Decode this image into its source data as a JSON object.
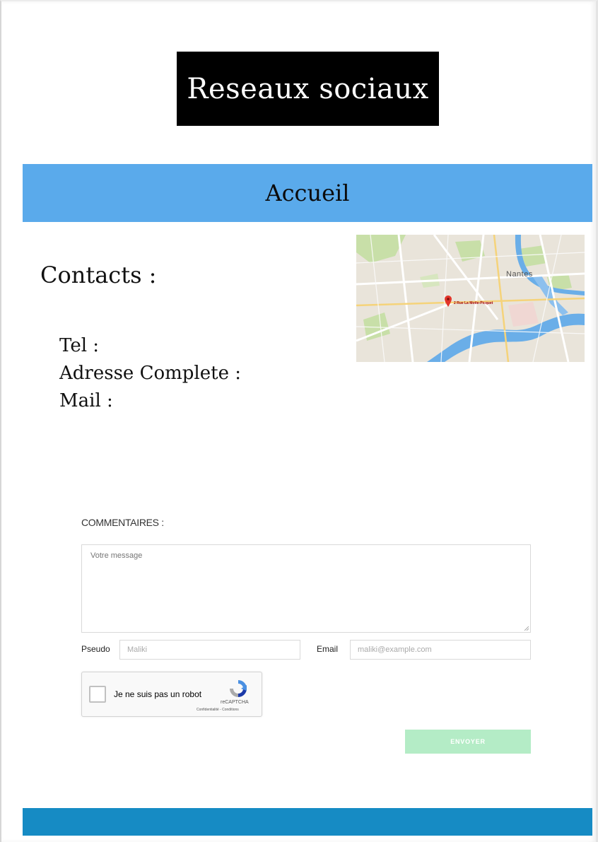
{
  "header": {
    "logo_text": "Reseaux sociaux"
  },
  "nav": {
    "label": "Accueil",
    "color": "#5aaaeb"
  },
  "contacts": {
    "title": "Contacts :",
    "lines": [
      "Tel :",
      "Adresse Complete :",
      "Mail :"
    ]
  },
  "map": {
    "city_label": "Nantes",
    "address_label": "2 Rue La Motte-Picquet",
    "marker_icon": "map-pin-icon"
  },
  "comments": {
    "label": "COMMENTAIRES :",
    "message_placeholder": "Votre message",
    "pseudo_label": "Pseudo",
    "pseudo_value": "Maliki",
    "email_label": "Email",
    "email_value": "maliki@example.com"
  },
  "captcha": {
    "label": "Je ne suis pas un robot",
    "brand": "reCAPTCHA",
    "links": "Confidentialité - Conditions",
    "checked": false
  },
  "send_button": {
    "label": "ENVOYER",
    "color": "#b4ecc6"
  },
  "footer": {
    "color": "#168bc4"
  }
}
